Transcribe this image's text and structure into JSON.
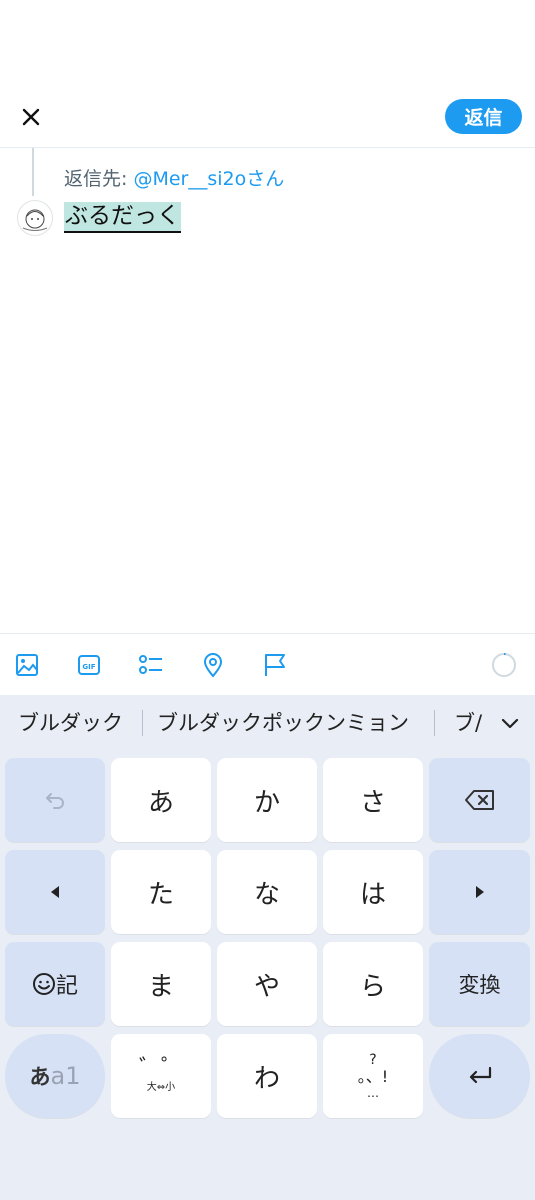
{
  "header": {
    "reply_label": "返信"
  },
  "reply": {
    "prefix": "返信先: ",
    "handle": "@Mer__si2oさん",
    "text": "ぶるだっく"
  },
  "toolbar": {
    "icons": [
      "image-icon",
      "gif-icon",
      "poll-icon",
      "location-icon",
      "flag-icon"
    ],
    "gif_label": "GIF"
  },
  "keyboard": {
    "candidates": [
      "ブルダック",
      "ブルダックポックンミョン",
      "ブ/"
    ],
    "row1": {
      "center": [
        "あ",
        "か",
        "さ"
      ]
    },
    "row2": {
      "center": [
        "た",
        "な",
        "は"
      ]
    },
    "row3": {
      "left": "記",
      "center": [
        "ま",
        "や",
        "ら"
      ],
      "right": "変換"
    },
    "row4": {
      "mode_a": "あ",
      "mode_b": "a1",
      "modifier_main": "゛゜",
      "modifier_sub": "大⇔小",
      "wa": "わ",
      "punct_top": "?",
      "punct_mid": "。、!",
      "punct_bottom": "…"
    }
  },
  "colors": {
    "accent": "#1d9bf0",
    "keyboard_bg": "#e9edf5",
    "fn_key": "#d6e1f5"
  }
}
